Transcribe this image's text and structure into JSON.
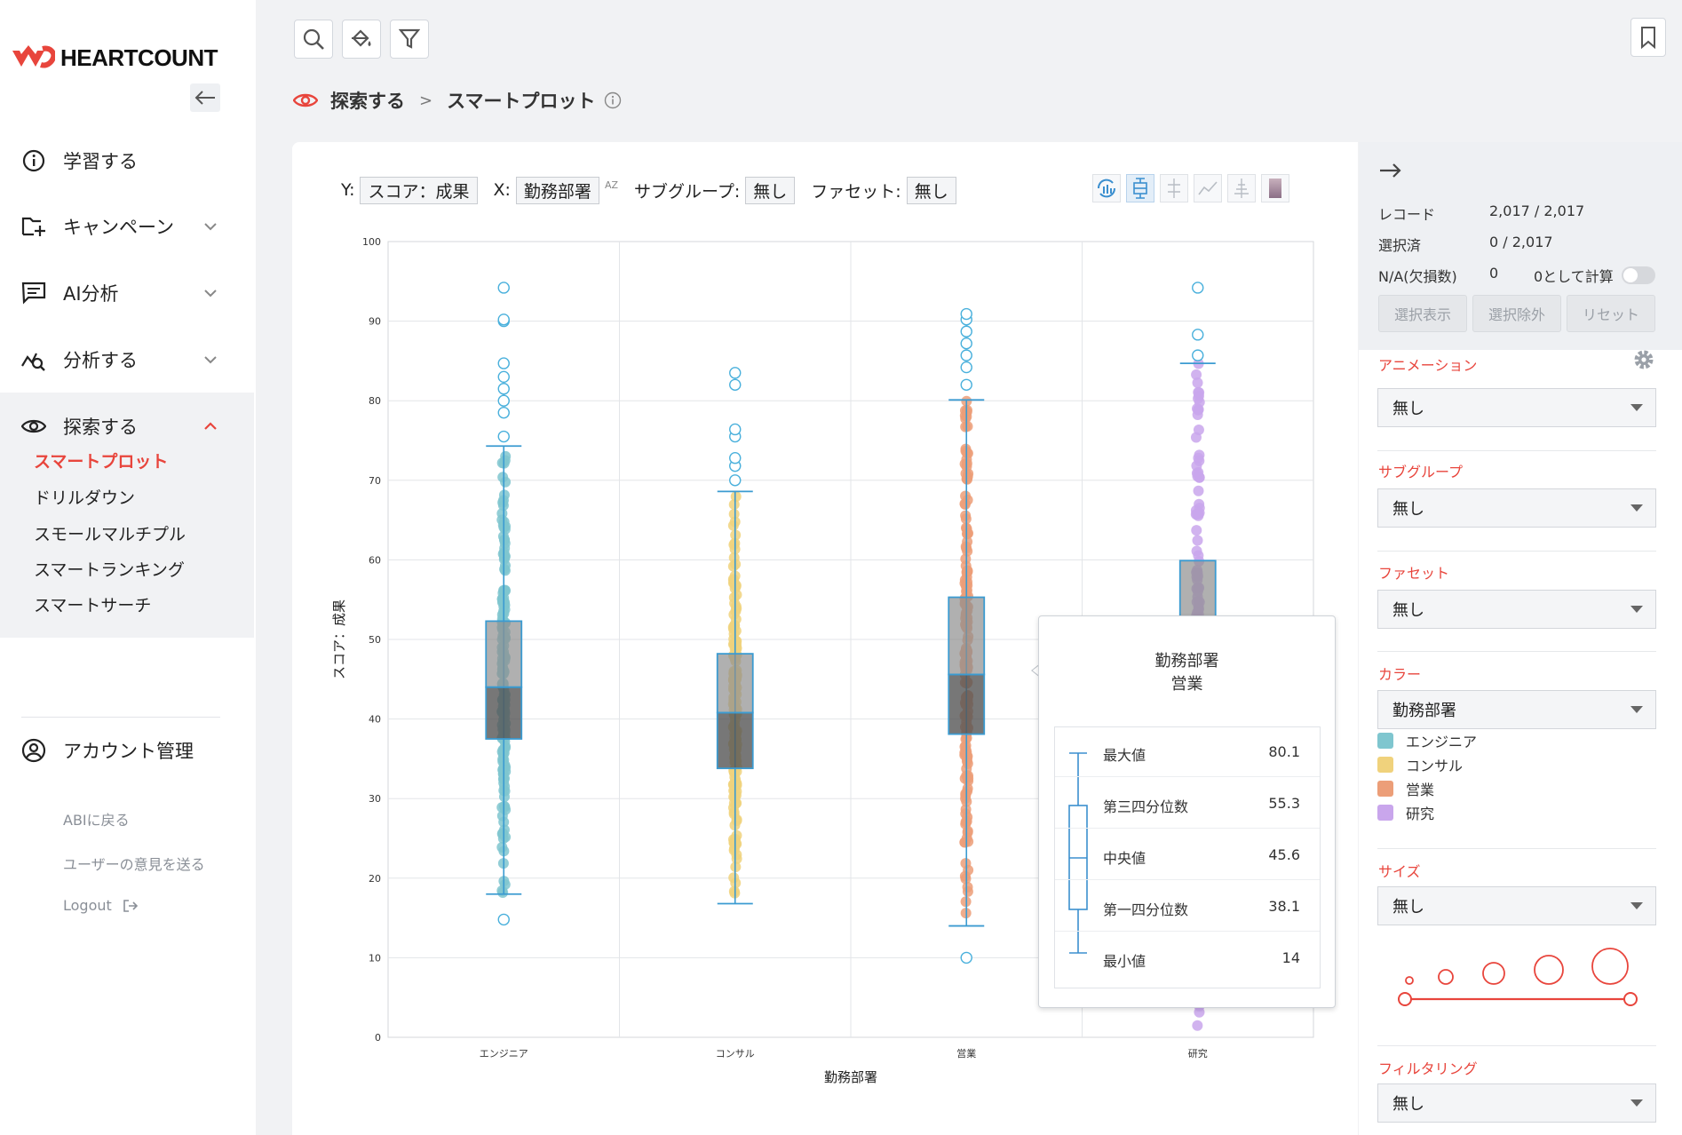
{
  "brand": {
    "name": "HEARTCOUNT",
    "accent": "#e8453c"
  },
  "sidebar": {
    "items": [
      {
        "label": "学習する",
        "icon": "info-circle-icon"
      },
      {
        "label": "キャンペーン",
        "icon": "folder-plus-icon"
      },
      {
        "label": "AI分析",
        "icon": "chat-icon"
      },
      {
        "label": "分析する",
        "icon": "chart-search-icon"
      },
      {
        "label": "探索する",
        "icon": "eye-icon"
      }
    ],
    "explore_sub": [
      "スマートプロット",
      "ドリルダウン",
      "スモールマルチプル",
      "スマートランキング",
      "スマートサーチ"
    ],
    "account": "アカウント管理",
    "footer": {
      "back": "ABIに戻る",
      "feedback": "ユーザーの意見を送る",
      "logout": "Logout"
    }
  },
  "breadcrumb": {
    "root": "探索する",
    "sep": ">",
    "current": "スマートプロット"
  },
  "axis_controls": {
    "y_label": "Y:",
    "y_value": "スコア：成果",
    "x_label": "X:",
    "x_value": "勤務部署",
    "sort": "AZ",
    "subgroup_label": "サブグループ:",
    "subgroup_value": "無し",
    "facet_label": "ファセット:",
    "facet_value": "無し"
  },
  "chart_data": {
    "type": "boxplot",
    "xlabel": "勤務部署",
    "ylabel": "スコア：成果",
    "ylim": [
      0,
      100
    ],
    "yticks": [
      0,
      10,
      20,
      30,
      40,
      50,
      60,
      70,
      80,
      90,
      100
    ],
    "grid": true,
    "categories": [
      "エンジニア",
      "コンサル",
      "営業",
      "研究"
    ],
    "colors": [
      "#7fc6cf",
      "#f0d27c",
      "#ec9e78",
      "#c9a6ec"
    ],
    "boxes": [
      {
        "min": 18,
        "q1": 37.5,
        "median": 44,
        "q3": 52.3,
        "max": 74.3,
        "outliers": [
          14.8,
          75.5,
          78.5,
          80,
          81.5,
          83,
          84.7,
          90,
          90.2,
          94.2
        ]
      },
      {
        "min": 16.8,
        "q1": 33.8,
        "median": 40.8,
        "q3": 48.2,
        "max": 68.6,
        "outliers": [
          70,
          71.8,
          72.8,
          75.5,
          76.4,
          82,
          83.5
        ]
      },
      {
        "min": 14,
        "q1": 38.1,
        "median": 45.6,
        "q3": 55.3,
        "max": 80.1,
        "outliers": [
          10,
          82,
          84.2,
          85.7,
          87.2,
          88.7,
          90.2,
          90.9
        ]
      },
      {
        "min": null,
        "q1": null,
        "median": null,
        "q3": 59.9,
        "max": 84.7,
        "outliers": [
          85.7,
          88.3,
          94.2
        ]
      }
    ]
  },
  "tooltip": {
    "title": "勤務部署",
    "subtitle": "営業",
    "rows": [
      {
        "label": "最大値",
        "value": "80.1"
      },
      {
        "label": "第三四分位数",
        "value": "55.3"
      },
      {
        "label": "中央値",
        "value": "45.6"
      },
      {
        "label": "第一四分位数",
        "value": "38.1"
      },
      {
        "label": "最小値",
        "value": "14"
      }
    ]
  },
  "right_panel": {
    "records_label": "レコード",
    "records_value": "2,017 / 2,017",
    "selected_label": "選択済",
    "selected_value": "0 / 2,017",
    "na_label": "N/A(欠損数)",
    "na_value": "0",
    "zero_calc_label": "0として計算",
    "buttons": [
      "選択表示",
      "選択除外",
      "リセット"
    ],
    "animation_label": "アニメーション",
    "animation_value": "無し",
    "subgroup_label": "サブグループ",
    "subgroup_value": "無し",
    "facet_label": "ファセット",
    "facet_value": "無し",
    "color_label": "カラー",
    "color_value": "勤務部署",
    "legend": [
      {
        "name": "エンジニア",
        "color": "#7fc6cf"
      },
      {
        "name": "コンサル",
        "color": "#f0d27c"
      },
      {
        "name": "営業",
        "color": "#ec9e78"
      },
      {
        "name": "研究",
        "color": "#c9a6ec"
      }
    ],
    "size_label": "サイズ",
    "size_value": "無し",
    "filter_label": "フィルタリング",
    "filter_value": "無し"
  }
}
